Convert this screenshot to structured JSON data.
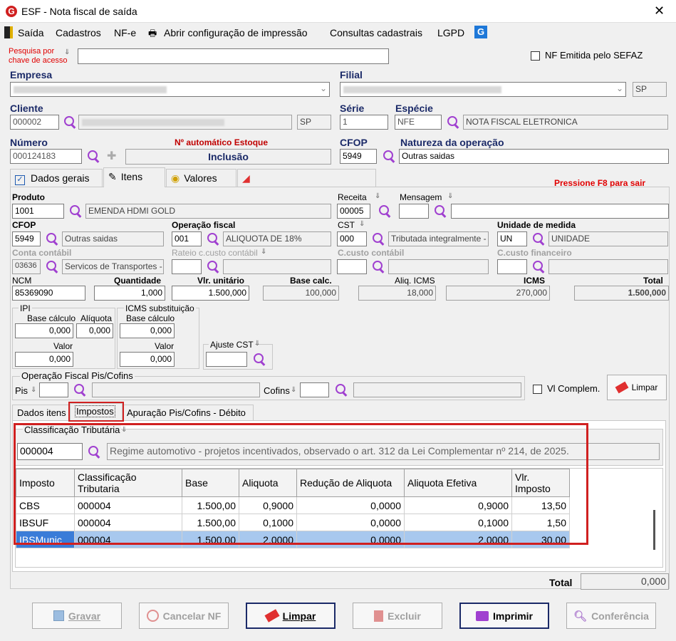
{
  "window": {
    "title": "ESF - Nota fiscal de saída"
  },
  "menu": {
    "items": [
      "Saída",
      "Cadastros",
      "NF-e",
      "Abrir configuração de impressão",
      "Consultas cadastrais",
      "LGPD"
    ]
  },
  "search": {
    "label_line1": "Pesquisa por",
    "label_line2": "chave de acesso",
    "value": ""
  },
  "nf_emitida": {
    "label": "NF Emitida pelo SEFAZ"
  },
  "empresa": {
    "label": "Empresa"
  },
  "filial": {
    "label": "Filial",
    "uf": "SP"
  },
  "cliente": {
    "label": "Cliente",
    "code": "000002",
    "uf": "SP"
  },
  "serie": {
    "label": "Série",
    "value": "1"
  },
  "especie": {
    "label": "Espécie",
    "code": "NFE",
    "desc": "NOTA FISCAL ELETRONICA"
  },
  "numero": {
    "label": "Número",
    "value": "000124183",
    "auto_label": "Nº automático Estoque",
    "mode": "Inclusão"
  },
  "cfop_header": {
    "label": "CFOP",
    "value": "5949"
  },
  "natureza": {
    "label": "Natureza da operação",
    "value": "Outras saidas"
  },
  "main_tabs": [
    "Dados gerais",
    "Itens",
    "Valores"
  ],
  "hint": "Pressione F8 para sair",
  "item": {
    "produto_label": "Produto",
    "produto_code": "1001",
    "produto_desc": "EMENDA HDMI GOLD",
    "receita_label": "Receita",
    "receita_value": "00005",
    "mensagem_label": "Mensagem",
    "cfop_label": "CFOP",
    "cfop_value": "5949",
    "cfop_desc": "Outras saidas",
    "opfiscal_label": "Operação fiscal",
    "opfiscal_code": "001",
    "opfiscal_desc": "ALIQUOTA DE 18%",
    "cst_label": "CST",
    "cst_code": "000",
    "cst_desc": "Tributada integralmente - N",
    "um_label": "Unidade de medida",
    "um_code": "UN",
    "um_desc": "UNIDADE",
    "conta_label": "Conta contábil",
    "conta_code": "03636",
    "conta_desc": "Servicos de Transportes -",
    "rateio_label": "Rateio c.custo contábil",
    "ccusto_label": "C.custo contábil",
    "ccusto_fin_label": "C.custo financeiro",
    "ncm_label": "NCM",
    "ncm_value": "85369090",
    "qtd_label": "Quantidade",
    "qtd_value": "1,000",
    "vunit_label": "Vlr. unitário",
    "vunit_value": "1.500,000",
    "base_label": "Base calc.",
    "base_value": "100,000",
    "aliq_label": "Aliq. ICMS",
    "aliq_value": "18,000",
    "icms_label": "ICMS",
    "icms_value": "270,000",
    "total_label": "Total",
    "total_value": "1.500,000"
  },
  "ipi": {
    "title": "IPI",
    "base_label": "Base cálculo",
    "aliq_label": "Alíquota",
    "base_value": "0,000",
    "aliq_value": "0,000",
    "valor_label": "Valor",
    "valor_value": "0,000"
  },
  "icmsst": {
    "title": "ICMS substituição",
    "base_label": "Base cálculo",
    "base_value": "0,000",
    "valor_label": "Valor",
    "valor_value": "0,000"
  },
  "ajuste": {
    "label": "Ajuste CST"
  },
  "piscofins": {
    "title": "Operação Fiscal Pis/Cofins",
    "pis_label": "Pis",
    "cofins_label": "Cofins"
  },
  "vl_complem": {
    "label": "Vl Complem."
  },
  "limpar_small": "Limpar",
  "sub_tabs": [
    "Dados itens",
    "Impostos",
    "Apuração Pis/Cofins - Débito"
  ],
  "classificacao": {
    "title": "Classificação Tributária",
    "code": "000004",
    "desc": "Regime automotivo - projetos incentivados, observado o art. 312 da Lei Complementar nº 214, de 2025."
  },
  "tax_table": {
    "headers": [
      "Imposto",
      "Classificação Tributaria",
      "Base",
      "Aliquota",
      "Redução de Aliquota",
      "Aliquota Efetiva",
      "Vlr. Imposto"
    ],
    "rows": [
      [
        "CBS",
        "000004",
        "1.500,00",
        "0,9000",
        "0,0000",
        "0,9000",
        "13,50"
      ],
      [
        "IBSUF",
        "000004",
        "1.500,00",
        "0,1000",
        "0,0000",
        "0,1000",
        "1,50"
      ],
      [
        "IBSMunic",
        "000004",
        "1.500,00",
        "2,0000",
        "0,0000",
        "2,0000",
        "30,00"
      ]
    ]
  },
  "footer_total": {
    "label": "Total",
    "value": "0,000"
  },
  "buttons": {
    "gravar": "Gravar",
    "cancelar": "Cancelar NF",
    "limpar": "Limpar",
    "excluir": "Excluir",
    "imprimir": "Imprimir",
    "conferencia": "Conferência"
  },
  "colors": {
    "label_blue": "#1b2a68",
    "red": "#e00000",
    "highlight": "#d02020",
    "sel_row": "#3a7cd8"
  }
}
